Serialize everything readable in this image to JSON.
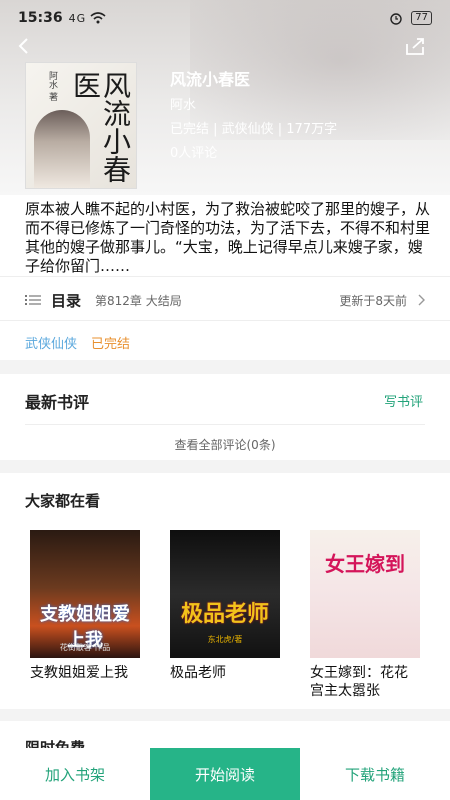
{
  "status_bar": {
    "time": "15:36",
    "signal": "4G",
    "battery": "77"
  },
  "book": {
    "title": "风流小春医",
    "author": "阿水",
    "meta": "已完结 | 武侠仙侠 | 177万字",
    "comments": "0人评论",
    "cover_title": "风流小春医",
    "cover_author": "阿水 著",
    "description": "原本被人瞧不起的小村医，为了救治被蛇咬了那里的嫂子，从而不得已修炼了一门奇怪的功法，为了活下去，不得不和村里其他的嫂子做那事儿。“大宝，晚上记得早点儿来嫂子家，嫂子给你留门……"
  },
  "toc": {
    "label": "目录",
    "chapter": "第812章 大结局",
    "updated": "更新于8天前"
  },
  "tags": {
    "genre": "武侠仙侠",
    "status": "已完结"
  },
  "reviews": {
    "title": "最新书评",
    "write_label": "写书评",
    "view_all": "查看全部评论(0条)"
  },
  "recommend": {
    "title": "大家都在看",
    "items": [
      {
        "name": "支教姐姐爱上我",
        "cover_text": "支教姐姐爱上我",
        "cover_sub": "花街散客 作品"
      },
      {
        "name": "极品老师",
        "cover_text": "极品老师",
        "cover_sub": "东北虎/著"
      },
      {
        "name": "女王嫁到：花花宫主太嚣张",
        "cover_text": "女王嫁到",
        "cover_sub": ""
      }
    ]
  },
  "free": {
    "title": "限时免费"
  },
  "bottom": {
    "add_label": "加入书架",
    "read_label": "开始阅读",
    "download_label": "下载书籍"
  }
}
